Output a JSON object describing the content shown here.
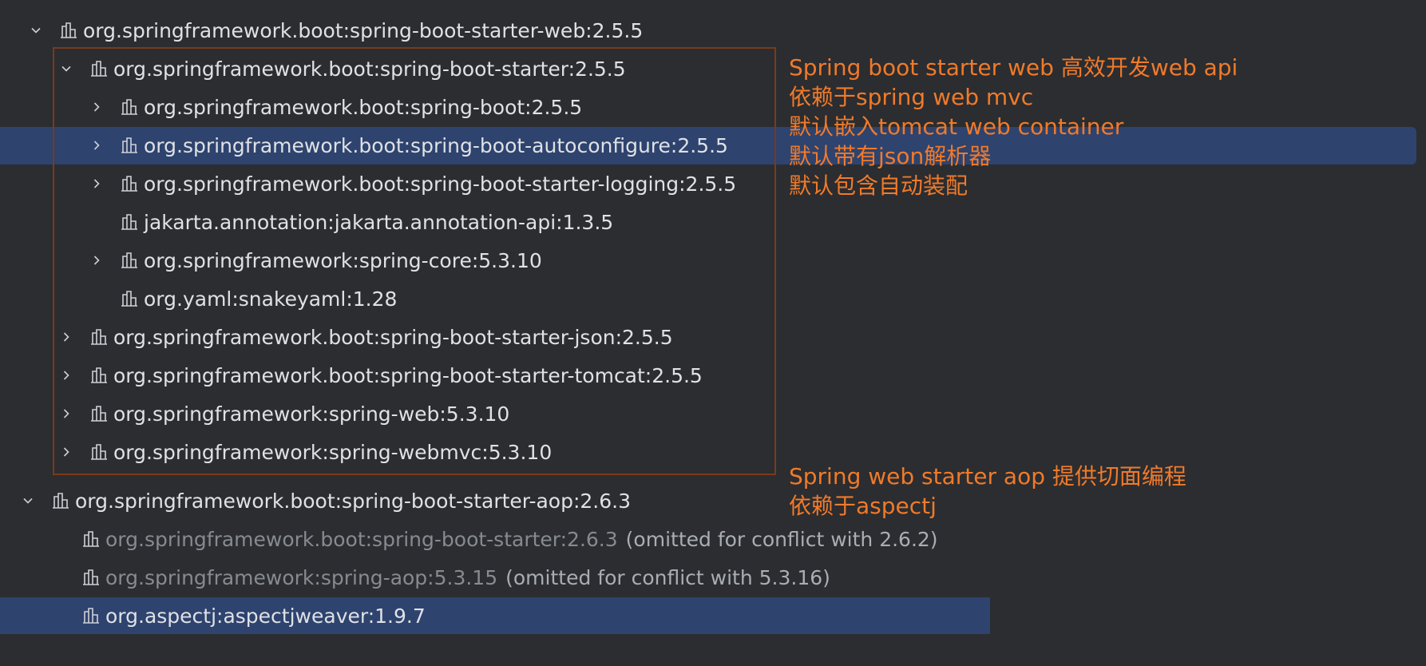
{
  "tree": {
    "root1": {
      "label": "org.springframework.boot:spring-boot-starter-web:2.5.5",
      "expanded": true
    },
    "starter": {
      "label": "org.springframework.boot:spring-boot-starter:2.5.5",
      "expanded": true
    },
    "starter_children": [
      {
        "label": "org.springframework.boot:spring-boot:2.5.5",
        "has_children": true
      },
      {
        "label": "org.springframework.boot:spring-boot-autoconfigure:2.5.5",
        "has_children": true,
        "selected": true
      },
      {
        "label": "org.springframework.boot:spring-boot-starter-logging:2.5.5",
        "has_children": true
      },
      {
        "label": "jakarta.annotation:jakarta.annotation-api:1.3.5",
        "has_children": false
      },
      {
        "label": "org.springframework:spring-core:5.3.10",
        "has_children": true
      },
      {
        "label": "org.yaml:snakeyaml:1.28",
        "has_children": false
      }
    ],
    "web_children": [
      {
        "label": "org.springframework.boot:spring-boot-starter-json:2.5.5"
      },
      {
        "label": "org.springframework.boot:spring-boot-starter-tomcat:2.5.5"
      },
      {
        "label": "org.springframework:spring-web:5.3.10"
      },
      {
        "label": "org.springframework:spring-webmvc:5.3.10"
      }
    ],
    "root2": {
      "label": "org.springframework.boot:spring-boot-starter-aop:2.6.3",
      "expanded": true
    },
    "aop_children": [
      {
        "label": "org.springframework.boot:spring-boot-starter:2.6.3",
        "note": "(omitted for conflict with 2.6.2)",
        "omitted": true
      },
      {
        "label": "org.springframework:spring-aop:5.3.15",
        "note": "(omitted for conflict with 5.3.16)",
        "omitted": true
      },
      {
        "label": "org.aspectj:aspectjweaver:1.9.7",
        "selected": true
      }
    ]
  },
  "annotations": {
    "web": [
      "Spring boot starter web 高效开发web api",
      "依赖于spring web mvc",
      "默认嵌入tomcat web container",
      "默认带有json解析器",
      "默认包含自动装配"
    ],
    "aop": [
      "Spring web starter aop 提供切面编程",
      "依赖于aspectj"
    ]
  },
  "colors": {
    "background": "#2b2d30",
    "selection": "#2e436e",
    "annotation": "#f07a2a",
    "frame": "#7a3a1c"
  }
}
